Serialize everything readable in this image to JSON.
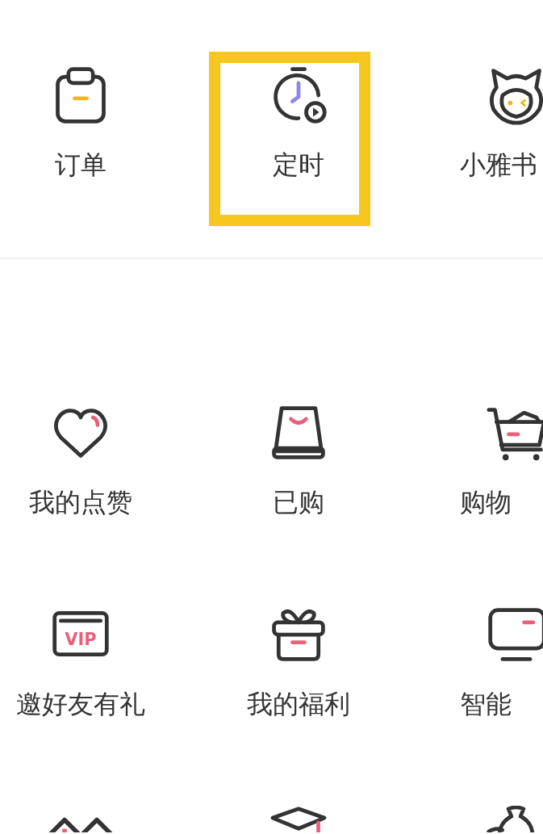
{
  "top_items": [
    {
      "label": "订单",
      "highlighted": false
    },
    {
      "label": "定时",
      "highlighted": true
    },
    {
      "label": "小雅书",
      "highlighted": false
    }
  ],
  "menu_rows": [
    [
      {
        "label": "我的点赞"
      },
      {
        "label": "已购"
      },
      {
        "label": "购物"
      }
    ],
    [
      {
        "label": "邀好友有礼",
        "badge": "VIP"
      },
      {
        "label": "我的福利"
      },
      {
        "label": "智能"
      }
    ]
  ]
}
